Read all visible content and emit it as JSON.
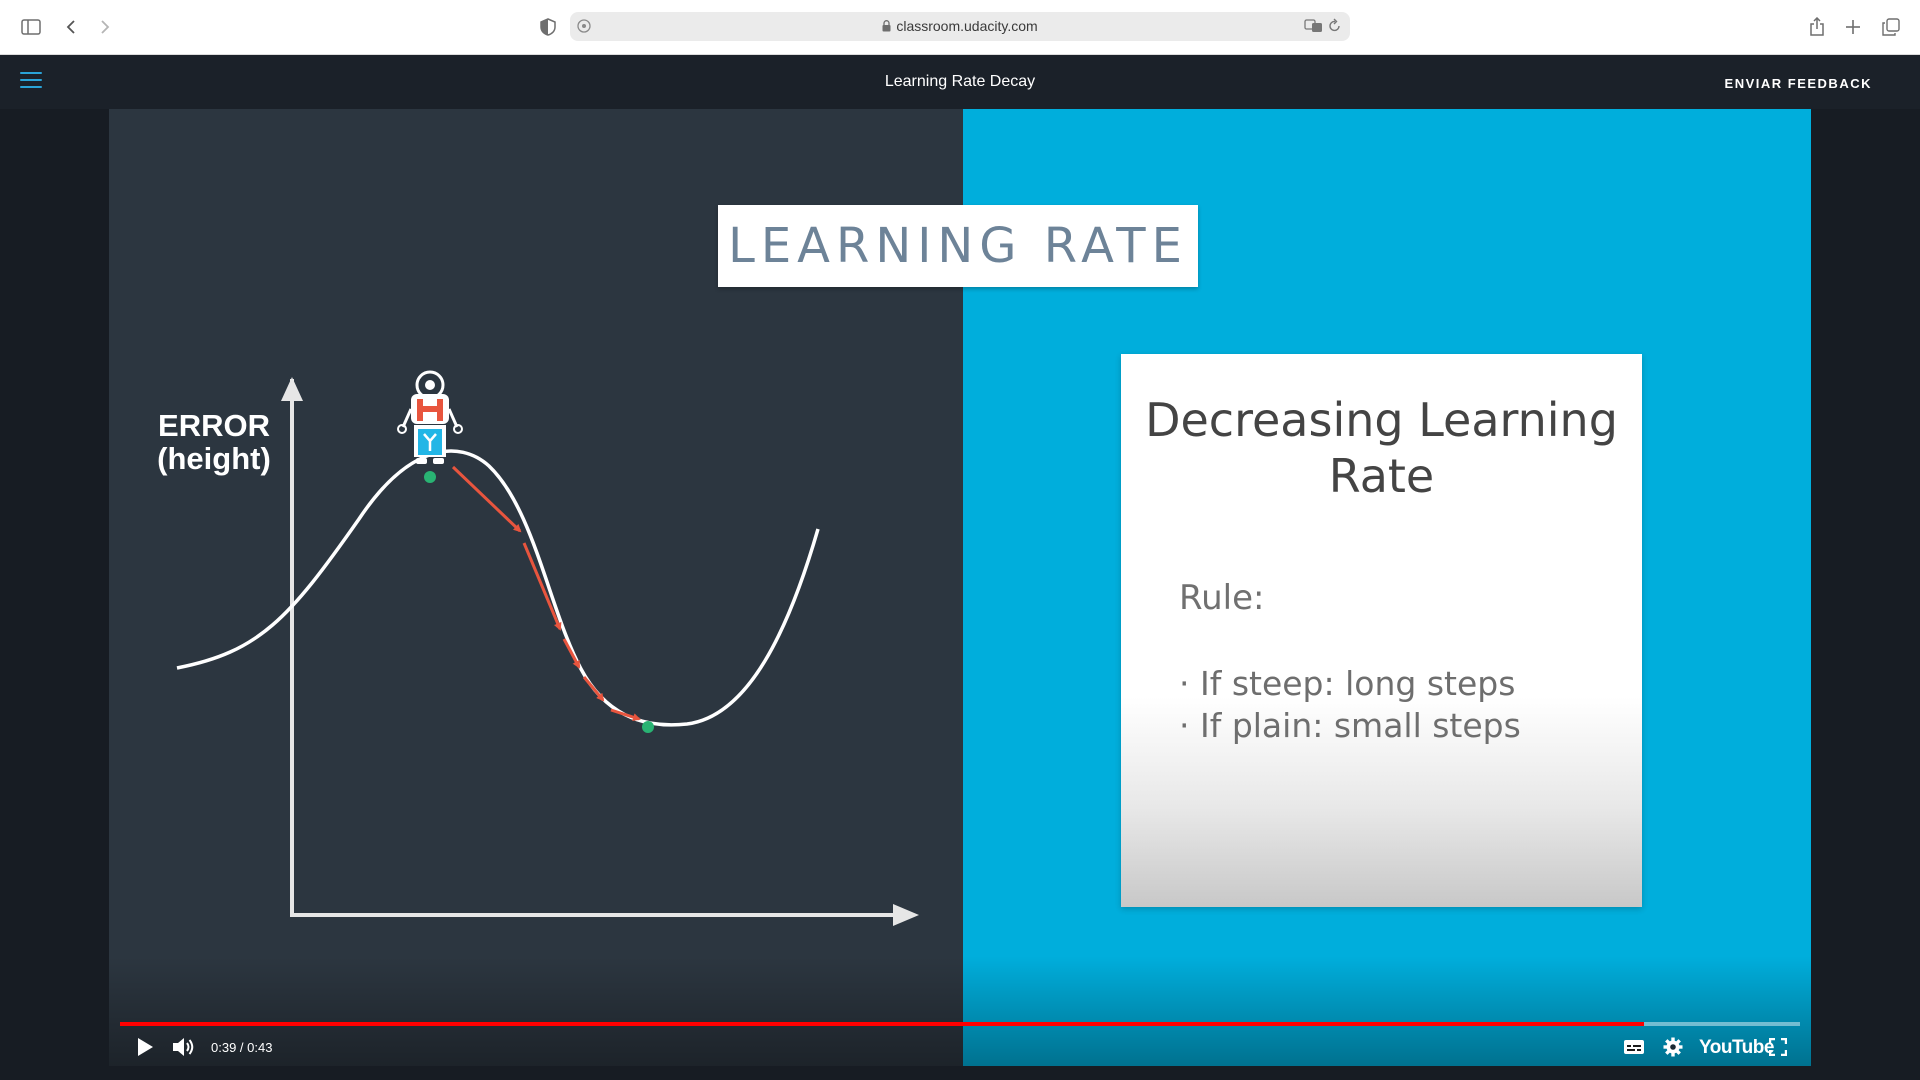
{
  "browser": {
    "url": "classroom.udacity.com"
  },
  "header": {
    "title": "Learning Rate Decay",
    "feedback_label": "ENVIAR FEEDBACK"
  },
  "slide": {
    "title": "LEARNING RATE",
    "graph": {
      "ylabel_line1": "ERROR",
      "ylabel_line2": "(height)"
    },
    "card": {
      "heading_line1": "Decreasing Learning",
      "heading_line2": "Rate",
      "rule_label": "Rule:",
      "rules": [
        "· If steep: long steps",
        "· If plain: small steps"
      ]
    }
  },
  "player": {
    "time": "0:39 / 0:43",
    "progress": 0.907,
    "logo": "YouTube"
  },
  "colors": {
    "accent": "#2aa3d7",
    "slide_dark": "#2c3640",
    "slide_blue": "#00aedc",
    "arrow_red": "#e8553e",
    "point_green": "#29b373",
    "progress_red": "#ff0000"
  }
}
